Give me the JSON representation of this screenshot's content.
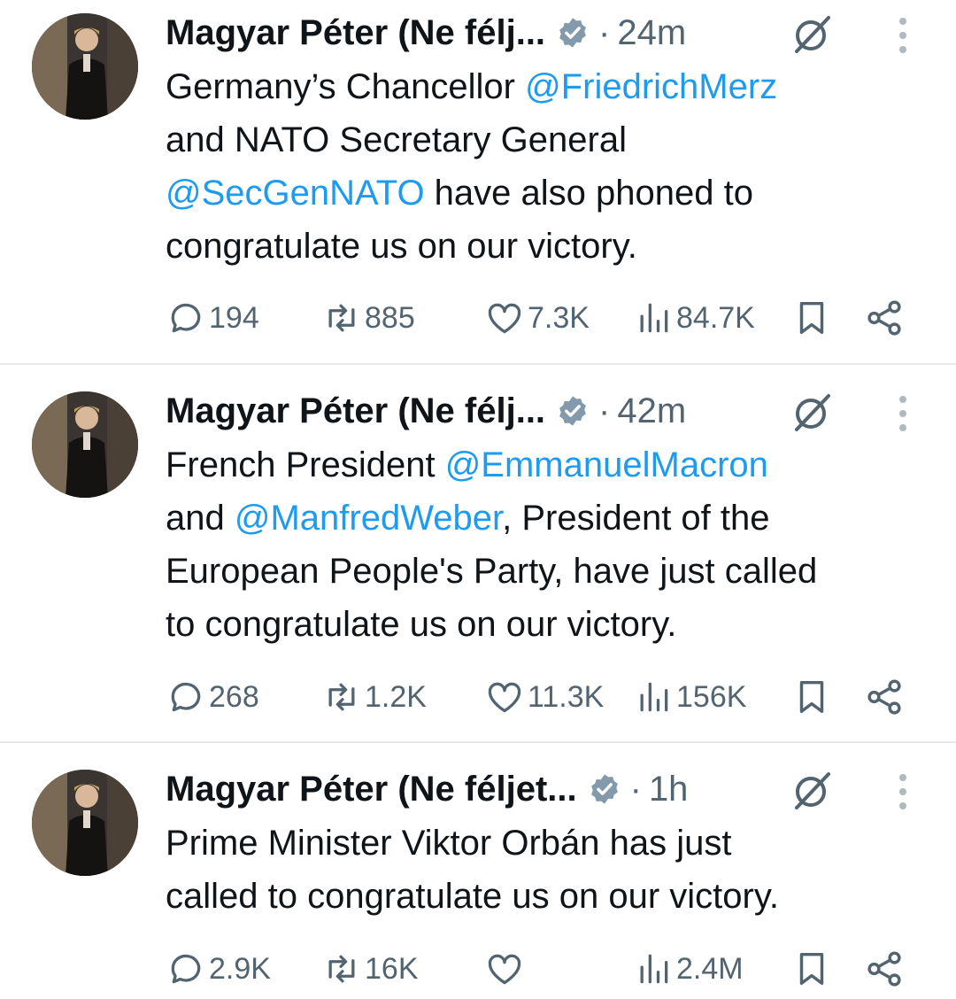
{
  "tweets": [
    {
      "author": "Magyar Péter (Ne félj...",
      "time": "24m",
      "text": [
        {
          "t": "Germany’s Chancellor ",
          "m": false
        },
        {
          "t": "@FriedrichMerz",
          "m": true
        },
        {
          "t": "\nand NATO Secretary General\n",
          "m": false
        },
        {
          "t": "@SecGenNATO",
          "m": true
        },
        {
          "t": " have also phoned to\ncongratulate us on our victory.",
          "m": false
        }
      ],
      "stats": {
        "replies": "194",
        "reposts": "885",
        "likes": "7.3K",
        "views": "84.7K"
      }
    },
    {
      "author": "Magyar Péter (Ne félj...",
      "time": "42m",
      "text": [
        {
          "t": "French President ",
          "m": false
        },
        {
          "t": "@EmmanuelMacron",
          "m": true
        },
        {
          "t": "\nand ",
          "m": false
        },
        {
          "t": "@ManfredWeber",
          "m": true
        },
        {
          "t": ", President of the\nEuropean People's Party, have just called\nto congratulate us on our victory.",
          "m": false
        }
      ],
      "stats": {
        "replies": "268",
        "reposts": "1.2K",
        "likes": "11.3K",
        "views": "156K"
      }
    },
    {
      "author": "Magyar Péter (Ne féljet...",
      "time": "1h",
      "text": [
        {
          "t": "Prime Minister Viktor Orbán has just\ncalled to congratulate us on our victory.",
          "m": false
        }
      ],
      "stats": {
        "replies": "2.9K",
        "reposts": "16K",
        "likes": "",
        "views": "2.4M"
      }
    }
  ],
  "icons": {
    "verified": "verified-badge-icon",
    "grok": "grok-icon",
    "more": "more-options-icon",
    "reply": "reply-icon",
    "repost": "repost-icon",
    "like": "like-icon",
    "views": "views-icon",
    "bookmark": "bookmark-icon",
    "share": "share-icon"
  },
  "colors": {
    "text": "#0f1419",
    "secondary": "#536471",
    "link": "#1d9bf0",
    "divider": "#e6e9ec",
    "verified": "#829aab"
  }
}
